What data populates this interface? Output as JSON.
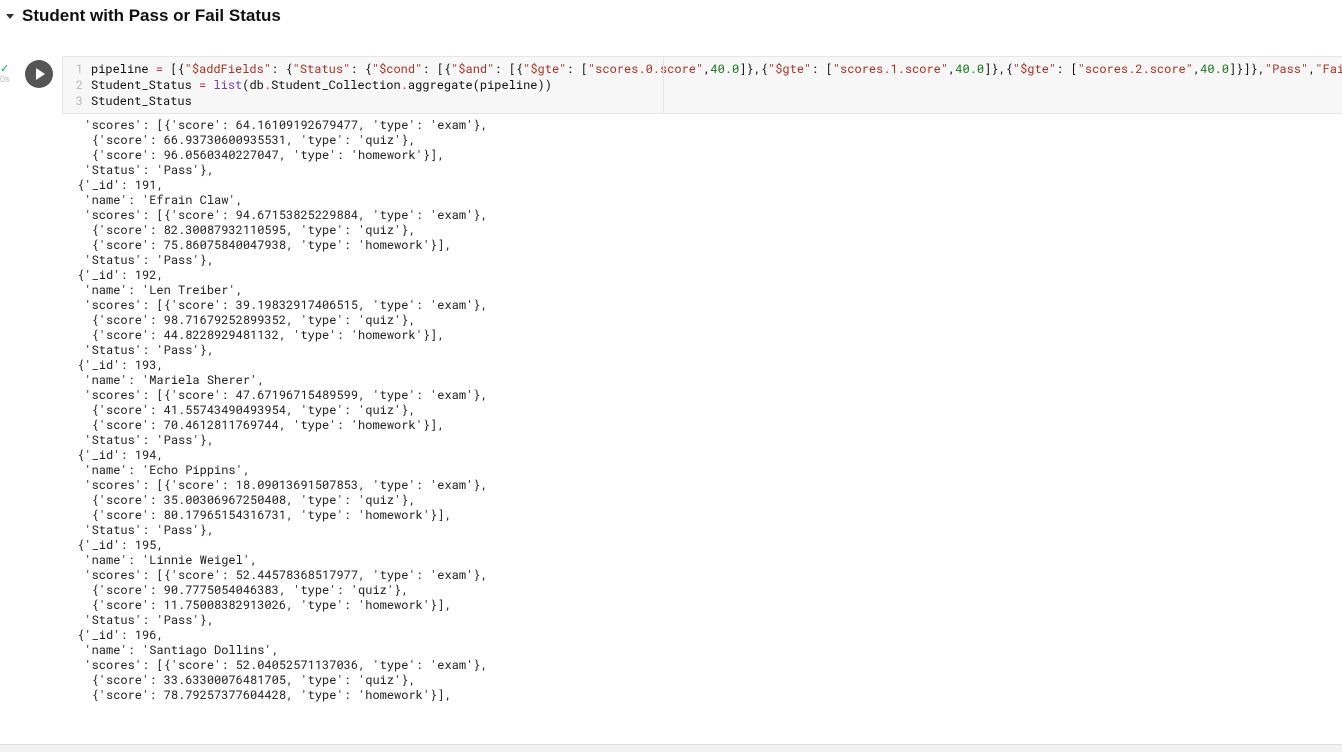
{
  "header": {
    "title": "Student with Pass or Fail Status"
  },
  "exec": {
    "time_label": "0s"
  },
  "code": {
    "lines": [
      {
        "num": "1",
        "tokens": [
          {
            "t": "pipeline ",
            "c": "tok-id"
          },
          {
            "t": "=",
            "c": "tok-op"
          },
          {
            "t": " [{",
            "c": "tok-id"
          },
          {
            "t": "\"$addFields\"",
            "c": "tok-str"
          },
          {
            "t": ": {",
            "c": "tok-id"
          },
          {
            "t": "\"Status\"",
            "c": "tok-str"
          },
          {
            "t": ": {",
            "c": "tok-id"
          },
          {
            "t": "\"$cond\"",
            "c": "tok-str"
          },
          {
            "t": ": [{",
            "c": "tok-id"
          },
          {
            "t": "\"$and\"",
            "c": "tok-str"
          },
          {
            "t": ": [{",
            "c": "tok-id"
          },
          {
            "t": "\"$gte\"",
            "c": "tok-str"
          },
          {
            "t": ": [",
            "c": "tok-id"
          },
          {
            "t": "\"scores.0.score\"",
            "c": "tok-str"
          },
          {
            "t": ",",
            "c": "tok-id"
          },
          {
            "t": "40.0",
            "c": "tok-num"
          },
          {
            "t": "]},{",
            "c": "tok-id"
          },
          {
            "t": "\"$gte\"",
            "c": "tok-str"
          },
          {
            "t": ": [",
            "c": "tok-id"
          },
          {
            "t": "\"scores.1.score\"",
            "c": "tok-str"
          },
          {
            "t": ",",
            "c": "tok-id"
          },
          {
            "t": "40.0",
            "c": "tok-num"
          },
          {
            "t": "]},{",
            "c": "tok-id"
          },
          {
            "t": "\"$gte\"",
            "c": "tok-str"
          },
          {
            "t": ": [",
            "c": "tok-id"
          },
          {
            "t": "\"scores.2.score\"",
            "c": "tok-str"
          },
          {
            "t": ",",
            "c": "tok-id"
          },
          {
            "t": "40.0",
            "c": "tok-num"
          },
          {
            "t": "]}]},",
            "c": "tok-id"
          },
          {
            "t": "\"Pass\"",
            "c": "tok-str"
          },
          {
            "t": ",",
            "c": "tok-id"
          },
          {
            "t": "\"Fail\"",
            "c": "tok-str"
          },
          {
            "t": "]}}}]",
            "c": "tok-id"
          }
        ]
      },
      {
        "num": "2",
        "tokens": [
          {
            "t": "Student_Status ",
            "c": "tok-id"
          },
          {
            "t": "=",
            "c": "tok-op"
          },
          {
            "t": " ",
            "c": "tok-id"
          },
          {
            "t": "list",
            "c": "tok-fn"
          },
          {
            "t": "(db",
            "c": "tok-id"
          },
          {
            "t": ".",
            "c": "tok-op"
          },
          {
            "t": "Student_Collection",
            "c": "tok-id"
          },
          {
            "t": ".",
            "c": "tok-op"
          },
          {
            "t": "aggregate(pipeline))",
            "c": "tok-id"
          }
        ]
      },
      {
        "num": "3",
        "tokens": [
          {
            "t": "Student_Status",
            "c": "tok-id"
          }
        ]
      }
    ]
  },
  "output_lines": [
    "  'scores': [{'score': 64.16109192679477, 'type': 'exam'},",
    "   {'score': 66.93730600935531, 'type': 'quiz'},",
    "   {'score': 96.0560340227047, 'type': 'homework'}],",
    "  'Status': 'Pass'},",
    " {'_id': 191,",
    "  'name': 'Efrain Claw',",
    "  'scores': [{'score': 94.67153825229884, 'type': 'exam'},",
    "   {'score': 82.30087932110595, 'type': 'quiz'},",
    "   {'score': 75.86075840047938, 'type': 'homework'}],",
    "  'Status': 'Pass'},",
    " {'_id': 192,",
    "  'name': 'Len Treiber',",
    "  'scores': [{'score': 39.19832917406515, 'type': 'exam'},",
    "   {'score': 98.71679252899352, 'type': 'quiz'},",
    "   {'score': 44.8228929481132, 'type': 'homework'}],",
    "  'Status': 'Pass'},",
    " {'_id': 193,",
    "  'name': 'Mariela Sherer',",
    "  'scores': [{'score': 47.67196715489599, 'type': 'exam'},",
    "   {'score': 41.55743490493954, 'type': 'quiz'},",
    "   {'score': 70.4612811769744, 'type': 'homework'}],",
    "  'Status': 'Pass'},",
    " {'_id': 194,",
    "  'name': 'Echo Pippins',",
    "  'scores': [{'score': 18.09013691507853, 'type': 'exam'},",
    "   {'score': 35.00306967250408, 'type': 'quiz'},",
    "   {'score': 80.17965154316731, 'type': 'homework'}],",
    "  'Status': 'Pass'},",
    " {'_id': 195,",
    "  'name': 'Linnie Weigel',",
    "  'scores': [{'score': 52.44578368517977, 'type': 'exam'},",
    "   {'score': 90.7775054046383, 'type': 'quiz'},",
    "   {'score': 11.75008382913026, 'type': 'homework'}],",
    "  'Status': 'Pass'},",
    " {'_id': 196,",
    "  'name': 'Santiago Dollins',",
    "  'scores': [{'score': 52.04052571137036, 'type': 'exam'},",
    "   {'score': 33.63300076481705, 'type': 'quiz'},",
    "   {'score': 78.79257377604428, 'type': 'homework'}],"
  ]
}
